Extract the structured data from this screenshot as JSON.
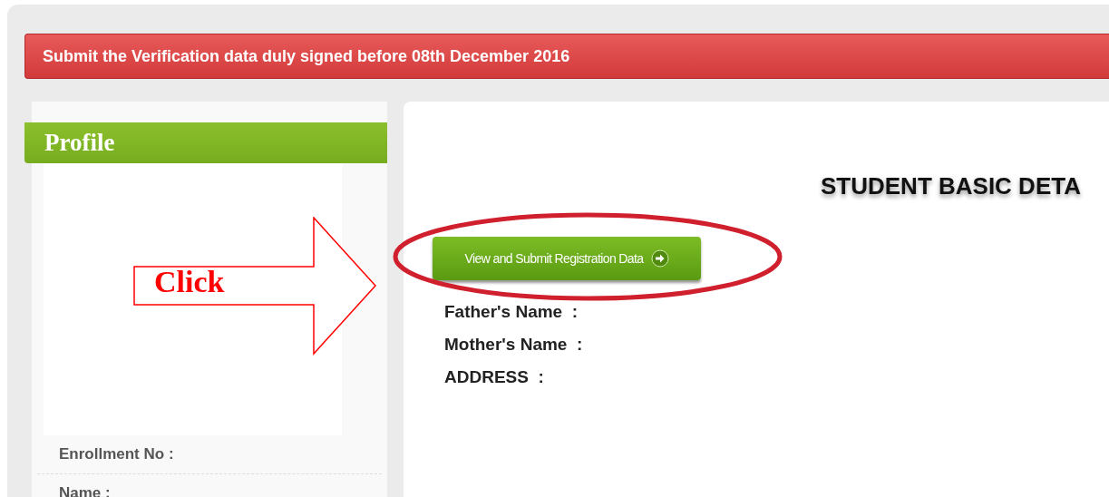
{
  "banner": {
    "text": "Submit the Verification data duly signed before 08th December 2016"
  },
  "profile": {
    "title": "Profile",
    "fields": [
      {
        "label": "Enrollment No :"
      },
      {
        "label": "Name :"
      }
    ]
  },
  "details": {
    "title": "STUDENT BASIC DETA",
    "button": "View and Submit Registration Data",
    "fields": [
      {
        "label": "Father's Name  :"
      },
      {
        "label": "Mother's Name  :"
      },
      {
        "label": "ADDRESS  :"
      }
    ]
  },
  "annotation": {
    "text": "Click"
  }
}
